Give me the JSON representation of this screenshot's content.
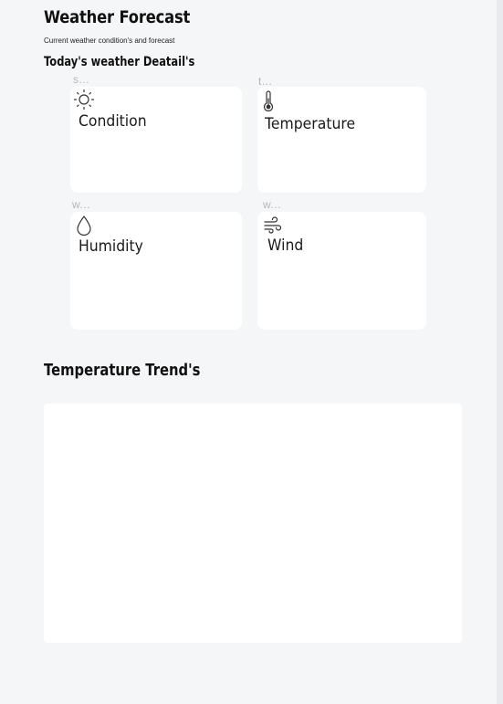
{
  "header": {
    "title": "Weather Forecast",
    "subtitle": "Current weather condition's and forecast"
  },
  "details": {
    "title": "Today's weather Deatail's",
    "cards": [
      {
        "caption": "s...",
        "label": "Condition",
        "icon": "sun-icon"
      },
      {
        "caption": "t...",
        "label": "Temperature",
        "icon": "thermometer-icon"
      },
      {
        "caption": "w...",
        "label": "Humidity",
        "icon": "droplet-icon"
      },
      {
        "caption": "w...",
        "label": "Wind",
        "icon": "wind-icon"
      }
    ]
  },
  "trend": {
    "title": "Temperature Trend's"
  }
}
